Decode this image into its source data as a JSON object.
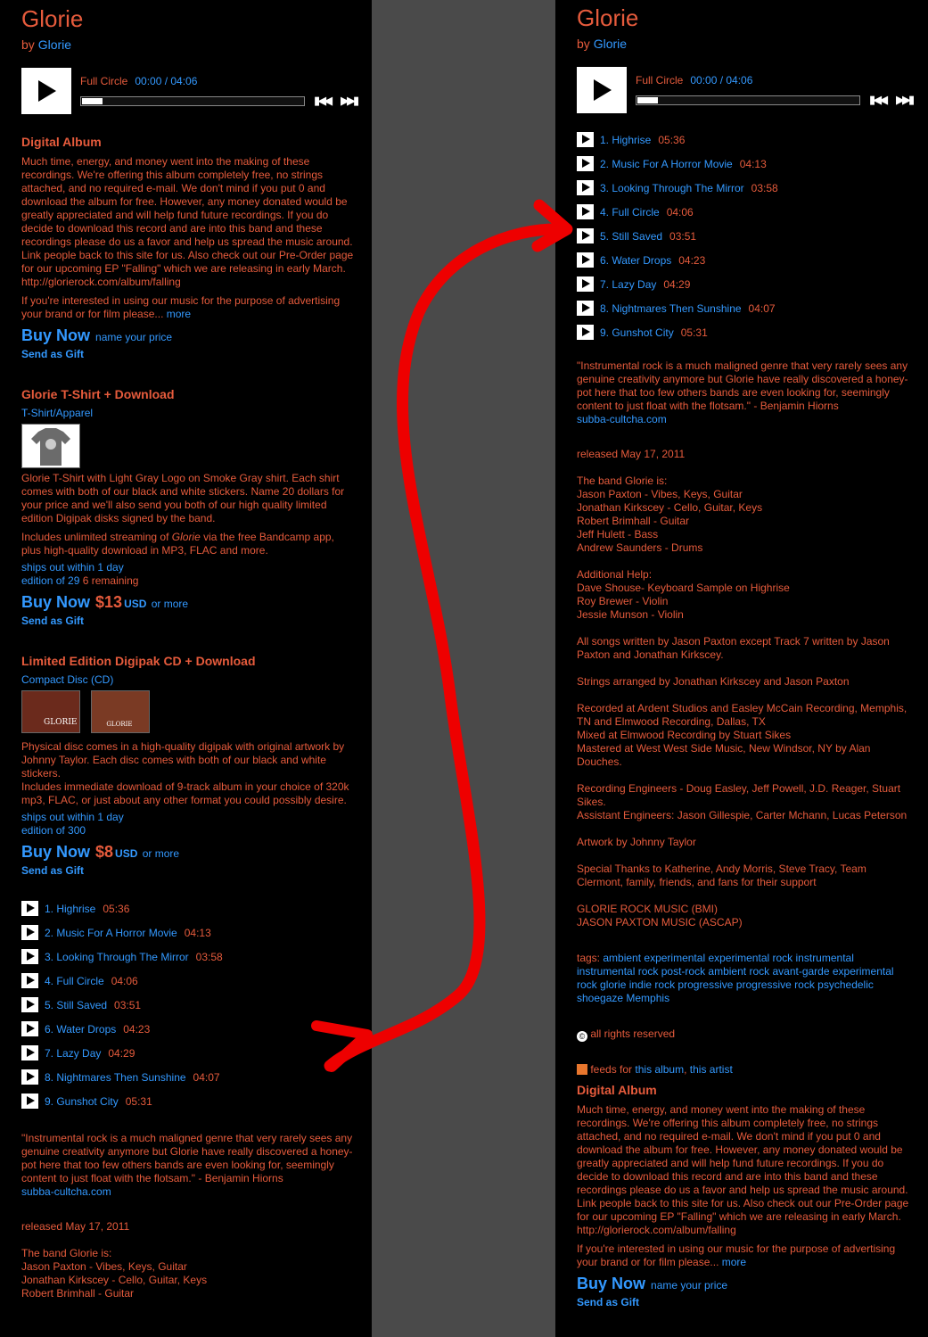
{
  "album": {
    "title": "Glorie",
    "by_label": "by",
    "artist": "Glorie"
  },
  "player": {
    "track": "Full Circle",
    "time": "00:00 / 04:06",
    "progress_fraction": 0.03
  },
  "digital_album": {
    "heading": "Digital Album",
    "description": "Much time, energy, and money went into the making of these recordings. We're offering this album completely free, no strings attached, and no required e-mail. We don't mind if you put 0 and download the album for free. However, any money donated would be greatly appreciated and will help fund future recordings. If you do decide to download this record and are into this band and these recordings please do us a favor and help us spread the music around. Link people back to this site for us. Also check out our Pre-Order page for our upcoming EP \"Falling\" which we are releasing in early March. http://glorierock.com/album/falling",
    "advertising": "If you're interested in using our music for the purpose of advertising your brand or for film please...",
    "more": "more",
    "buy": "Buy Now",
    "name_price": "name your price",
    "gift": "Send as Gift"
  },
  "tshirt": {
    "heading": "Glorie  T-Shirt + Download",
    "type": "T-Shirt/Apparel",
    "description": "Glorie T-Shirt with Light Gray Logo on Smoke Gray shirt. Each shirt comes with both of our black and white stickers. Name 20 dollars for your price and we'll also send you both of our high quality limited edition Digipak disks signed by the band.",
    "streaming_pre": "Includes unlimited streaming of",
    "streaming_album": "Glorie",
    "streaming_post": "via the free Bandcamp app, plus high-quality download in MP3, FLAC and more.",
    "ships": "ships out within 1 day",
    "edition": "edition of 29",
    "remaining": "6 remaining",
    "buy": "Buy Now",
    "price": "$13",
    "currency": "USD",
    "or_more": "or more",
    "gift": "Send as Gift"
  },
  "cd": {
    "heading": "Limited Edition Digipak CD + Download",
    "type": "Compact Disc (CD)",
    "thumb1": "GLORIE",
    "thumb2": "GLORIE",
    "description1": "Physical disc comes in a high-quality digipak with original artwork by Johnny Taylor. Each disc comes with both of our black and white stickers.",
    "description2": "Includes immediate download of 9-track album in your choice of 320k mp3, FLAC, or just about any other format you could possibly desire.",
    "ships": "ships out within 1 day",
    "edition": "edition of 300",
    "buy": "Buy Now",
    "price": "$8",
    "currency": "USD",
    "or_more": "or more",
    "gift": "Send as Gift"
  },
  "tracks": [
    {
      "name": "1. Highrise",
      "duration": "05:36"
    },
    {
      "name": "2. Music For A Horror Movie",
      "duration": "04:13"
    },
    {
      "name": "3. Looking Through The Mirror",
      "duration": "03:58"
    },
    {
      "name": "4. Full Circle",
      "duration": "04:06"
    },
    {
      "name": "5. Still Saved",
      "duration": "03:51"
    },
    {
      "name": "6. Water Drops",
      "duration": "04:23"
    },
    {
      "name": "7. Lazy Day",
      "duration": "04:29"
    },
    {
      "name": "8. Nightmares Then Sunshine",
      "duration": "04:07"
    },
    {
      "name": "9. Gunshot City",
      "duration": "05:31"
    }
  ],
  "quote": {
    "text": "\"Instrumental rock is a much maligned genre that very rarely sees any genuine creativity anymore but Glorie have really discovered a honey-pot here that too few others bands are even looking for, seemingly content to just float with the flotsam.\" - Benjamin Hiorns",
    "source": "subba-cultcha.com"
  },
  "released": "released May 17, 2011",
  "credits": {
    "band_heading": "The band Glorie is:",
    "band": [
      "Jason Paxton - Vibes, Keys, Guitar",
      "Jonathan Kirkscey - Cello, Guitar, Keys",
      "Robert Brimhall - Guitar",
      "Jeff Hulett - Bass",
      "Andrew Saunders - Drums"
    ],
    "help_heading": "Additional Help:",
    "help": [
      "Dave Shouse- Keyboard Sample on Highrise",
      "Roy Brewer - Violin",
      "Jessie Munson - Violin"
    ],
    "songs": "All songs written by Jason Paxton except Track 7 written by Jason Paxton and Jonathan Kirkscey.",
    "strings": "Strings arranged by Jonathan Kirkscey and Jason Paxton",
    "recorded": [
      "Recorded at Ardent Studios and Easley McCain Recording, Memphis, TN and Elmwood Recording, Dallas, TX",
      "Mixed at Elmwood Recording by Stuart Sikes",
      "Mastered at West West Side Music, New Windsor, NY by Alan Douches."
    ],
    "engineers": [
      "Recording Engineers - Doug Easley, Jeff Powell, J.D. Reager, Stuart Sikes.",
      "Assistant Engineers: Jason Gillespie, Carter Mchann, Lucas Peterson"
    ],
    "artwork": "Artwork by Johnny Taylor",
    "thanks": "Special Thanks to Katherine, Andy Morris, Steve Tracy, Team Clermont, family, friends, and fans for their support",
    "publishing": [
      "GLORIE ROCK MUSIC (BMI)",
      "JASON PAXTON MUSIC (ASCAP)"
    ]
  },
  "tags": {
    "label": "tags:",
    "items": [
      "ambient",
      "experimental",
      "experimental rock",
      "instrumental",
      "instrumental rock",
      "post-rock",
      "ambient rock",
      "avant-garde",
      "experimental rock",
      "glorie",
      "indie rock",
      "progressive",
      "progressive rock",
      "psychedelic",
      "shoegaze",
      "Memphis"
    ]
  },
  "rights": "all rights reserved",
  "feeds": {
    "label": "feeds for",
    "album": "this album",
    "artist": "this artist"
  },
  "colors": {
    "background": "#000000",
    "divider": "#4a4a4a",
    "text": "#e65b3c",
    "link": "#3399ff",
    "arrow": "#ee0000"
  }
}
